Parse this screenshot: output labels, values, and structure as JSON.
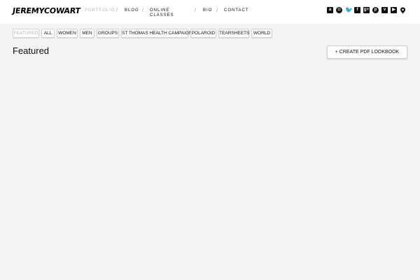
{
  "logo": "JEREMYCOWART",
  "nav": [
    {
      "label": "PORTFOLIO",
      "active": true
    },
    {
      "label": "BLOG"
    },
    {
      "label": "ONLINE CLASSES"
    },
    {
      "label": "BIO"
    },
    {
      "label": "CONTACT"
    }
  ],
  "nav_separator": "/",
  "social_icons": [
    {
      "name": "amazon-icon",
      "glyph": "a"
    },
    {
      "name": "instagram-icon",
      "glyph": "◘"
    },
    {
      "name": "twitter-icon",
      "glyph": "🐦"
    },
    {
      "name": "flickr-icon",
      "glyph": "f"
    },
    {
      "name": "google-plus-icon",
      "glyph": "g+"
    },
    {
      "name": "pinterest-icon",
      "glyph": "p"
    },
    {
      "name": "vimeo-icon",
      "glyph": "v"
    },
    {
      "name": "youtube-icon",
      "glyph": "▶"
    },
    {
      "name": "location-pin-icon",
      "glyph": ""
    }
  ],
  "filters": [
    {
      "label": "FEATURED",
      "active": true
    },
    {
      "label": "ALL"
    },
    {
      "label": "WOMEN"
    },
    {
      "label": "MEN"
    },
    {
      "label": "GROUPS"
    },
    {
      "label": "ST THOMAS HEALTH CAMPAIGN"
    },
    {
      "label": "POLAROID"
    },
    {
      "label": "TEARSHEETS"
    },
    {
      "label": "WORLD"
    }
  ],
  "page_title": "Featured",
  "pdf_button_label": "+ CREATE PDF LOOKBOOK",
  "colors": {
    "background": "#f4f4f4",
    "header": "#ffffff",
    "text": "#111111",
    "muted": "#b5b5b5"
  }
}
